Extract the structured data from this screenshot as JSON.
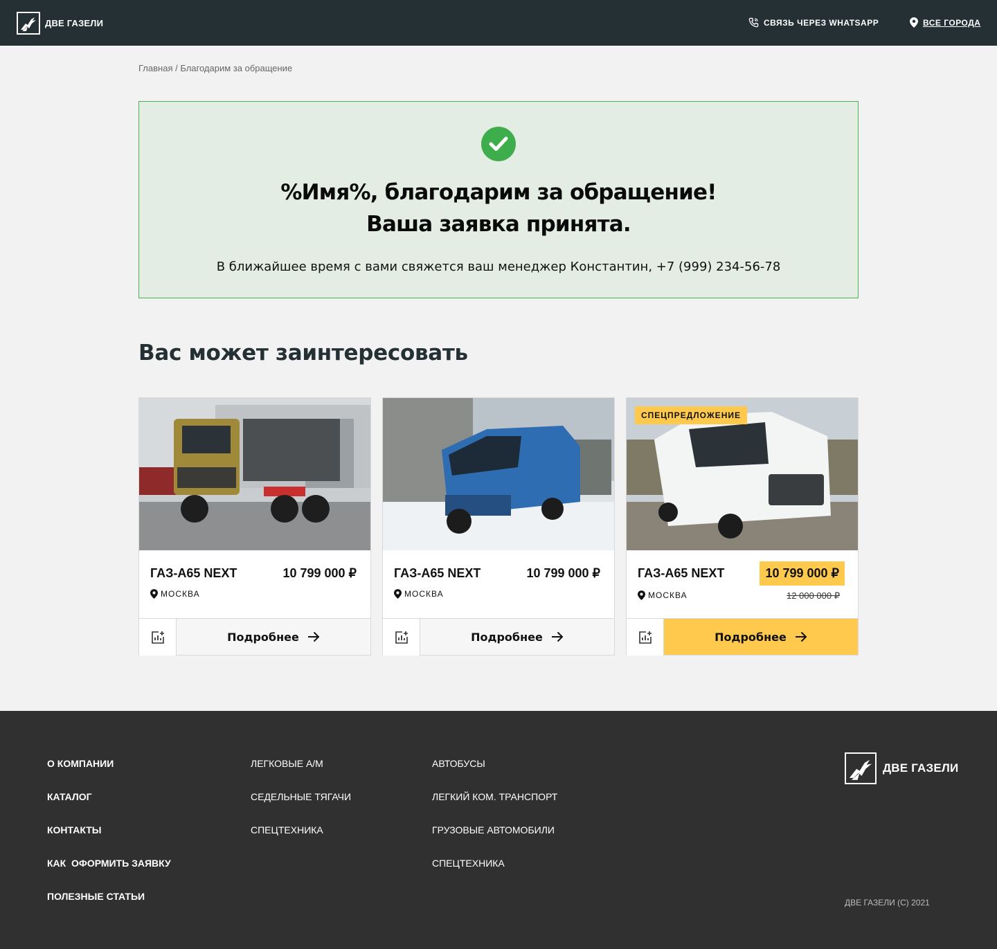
{
  "header": {
    "logo_text": "ДВЕ ГАЗЕЛИ",
    "whatsapp_label": "СВЯЗЬ ЧЕРЕЗ WHATSAPP",
    "city_label": "ВСЕ ГОРОДА"
  },
  "breadcrumb": {
    "home": "Главная",
    "separator": " / ",
    "current": "Благодарим за обращение"
  },
  "success": {
    "title_line1": "%Имя%, благодарим за обращение!",
    "title_line2": "Ваша заявка принята.",
    "text": "В ближайшее время с вами свяжется ваш менеджер Константин, +7 (999) 234-56-78"
  },
  "section_title": "Вас может заинтересовать",
  "cards": [
    {
      "name": "ГАЗ-А65 NEXT",
      "price": "10 799 000 ₽",
      "location": "МОСКВА",
      "button": "Подробнее"
    },
    {
      "name": "ГАЗ-А65 NEXT",
      "price": "10 799 000 ₽",
      "location": "МОСКВА",
      "button": "Подробнее"
    },
    {
      "name": "ГАЗ-А65 NEXT",
      "price": "10 799 000 ₽",
      "old_price": "12 000 000 ₽",
      "location": "МОСКВА",
      "badge": "СПЕЦПРЕДЛОЖЕНИЕ",
      "button": "Подробнее"
    }
  ],
  "footer": {
    "col1": [
      "О КОМПАНИИ",
      "КАТАЛОГ",
      "КОНТАКТЫ",
      "КАК  ОФОРМИТЬ ЗАЯВКУ",
      "ПОЛЕЗНЫЕ СТАТЬИ"
    ],
    "col2": [
      "ЛЕГКОВЫЕ А/М",
      "СЕДЕЛЬНЫЕ ТЯГАЧИ",
      "СПЕЦТЕХНИКА"
    ],
    "col3": [
      "АВТОБУСЫ",
      "ЛЕГКИЙ КОМ. ТРАНСПОРТ",
      "ГРУЗОВЫЕ АВТОМОБИЛИ",
      "СПЕЦТЕХНИКА"
    ],
    "logo_text": "ДВЕ ГАЗЕЛИ",
    "copyright": "ДВЕ ГАЗЕЛИ (C) 2021"
  },
  "colors": {
    "header_bg": "#253035",
    "accent_yellow": "#ffc94d",
    "success_green": "#3dae4b",
    "footer_bg": "#303030"
  }
}
